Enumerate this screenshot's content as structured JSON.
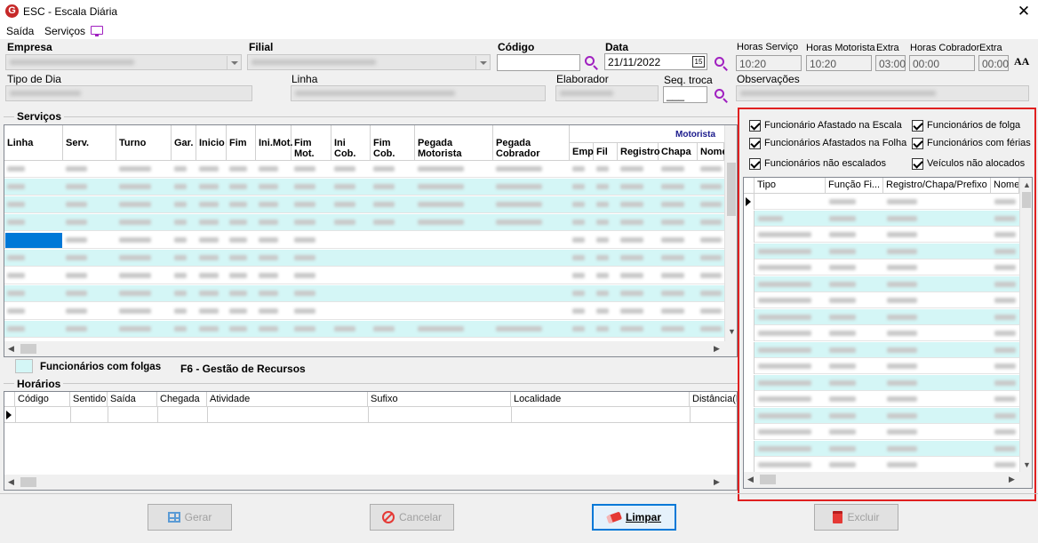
{
  "window": {
    "title": "ESC - Escala Diária",
    "close": "✕",
    "app_icon": "app-logo-icon"
  },
  "menu": {
    "items": [
      "Saída",
      "Serviços"
    ],
    "monitor_icon": "monitor-icon"
  },
  "form": {
    "empresa_label": "Empresa",
    "filial_label": "Filial",
    "codigo_label": "Código",
    "data_label": "Data",
    "data_value": "21/11/2022",
    "calendar_glyph": "15",
    "horas_servico_label": "Horas Serviço",
    "horas_servico_value": "10:20",
    "horas_motorista_label": "Horas Motorista",
    "horas_motorista_value": "10:20",
    "extra1_label": "Extra",
    "extra1_value": "03:00",
    "horas_cobrador_label": "Horas Cobrador",
    "horas_cobrador_value": "00:00",
    "extra2_label": "Extra",
    "extra2_value": "00:00",
    "font_glyph": "AA",
    "tipo_dia_label": "Tipo de Dia",
    "linha_label": "Linha",
    "elaborador_label": "Elaborador",
    "seq_troca_label": "Seq. troca",
    "seq_troca_value": "___",
    "observacoes_label": "Observações"
  },
  "servicos": {
    "group_label": "Serviços",
    "motorista_label": "Motorista",
    "columns": [
      "Linha",
      "Serv.",
      "Turno",
      "Gar.",
      "Inicio",
      "Fim",
      "Ini.Mot.",
      "Fim Mot.",
      "Ini Cob.",
      "Fim Cob.",
      "Pegada Motorista",
      "Pegada Cobrador"
    ],
    "sub_columns": [
      "Emp",
      "Fil",
      "Registro",
      "Chapa",
      "Nome"
    ],
    "row_count_shown": 10
  },
  "legend": {
    "label": "Funcionários com folgas",
    "f6_label": "F6 - Gestão de Recursos",
    "color": "#d4f6f6"
  },
  "horarios": {
    "group_label": "Horários",
    "columns": [
      "Código",
      "Sentido",
      "Saída",
      "Chegada",
      "Atividade",
      "Sufixo",
      "Localidade",
      "Distância(K"
    ]
  },
  "filters": {
    "left": [
      "Funcionário Afastado na Escala",
      "Funcionários Afastados na Folha",
      "Funcionários não escalados"
    ],
    "right": [
      "Funcionários de folga",
      "Funcionários com férias",
      "Veículos não alocados"
    ],
    "all_checked": true
  },
  "resources": {
    "columns": [
      "Tipo",
      "Função Fi...",
      "Registro/Chapa/Prefixo",
      "Nome"
    ]
  },
  "buttons": {
    "gerar": "Gerar",
    "cancelar": "Cancelar",
    "limpar": "Limpar",
    "excluir": "Excluir"
  },
  "colors": {
    "accent": "#a020c0",
    "highlight": "#e02020",
    "row_alt": "#d4f6f6",
    "selected": "#0078d7"
  }
}
